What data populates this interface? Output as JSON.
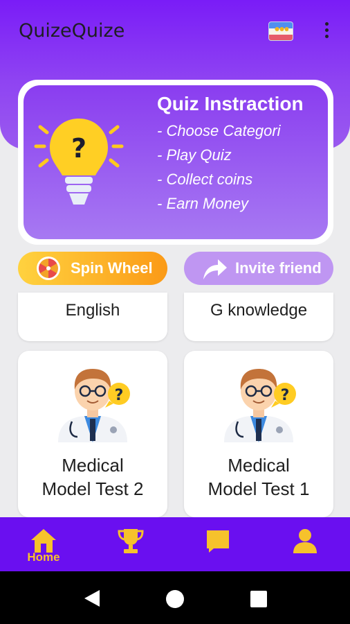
{
  "app": {
    "title": "QuizeQuize"
  },
  "banner": {
    "title": "Quiz Instraction",
    "steps": [
      "- Choose Categori",
      "- Play Quiz",
      "- Collect coins",
      "- Earn Money"
    ]
  },
  "actions": {
    "spin_label": "Spin Wheel",
    "invite_label": "Invite friend"
  },
  "categories": [
    {
      "label": "English"
    },
    {
      "label": "G knowledge"
    },
    {
      "label": "Medical\nModel Test 2"
    },
    {
      "label": "Medical\nModel Test 1"
    }
  ],
  "bottom_nav": [
    {
      "label": "Home",
      "icon": "home-icon"
    },
    {
      "label": "",
      "icon": "trophy-icon"
    },
    {
      "label": "",
      "icon": "chat-icon"
    },
    {
      "label": "",
      "icon": "profile-icon"
    }
  ],
  "colors": {
    "primary": "#7a1cf7",
    "accent": "#f6c22c",
    "nav": "#6a0ff0"
  }
}
